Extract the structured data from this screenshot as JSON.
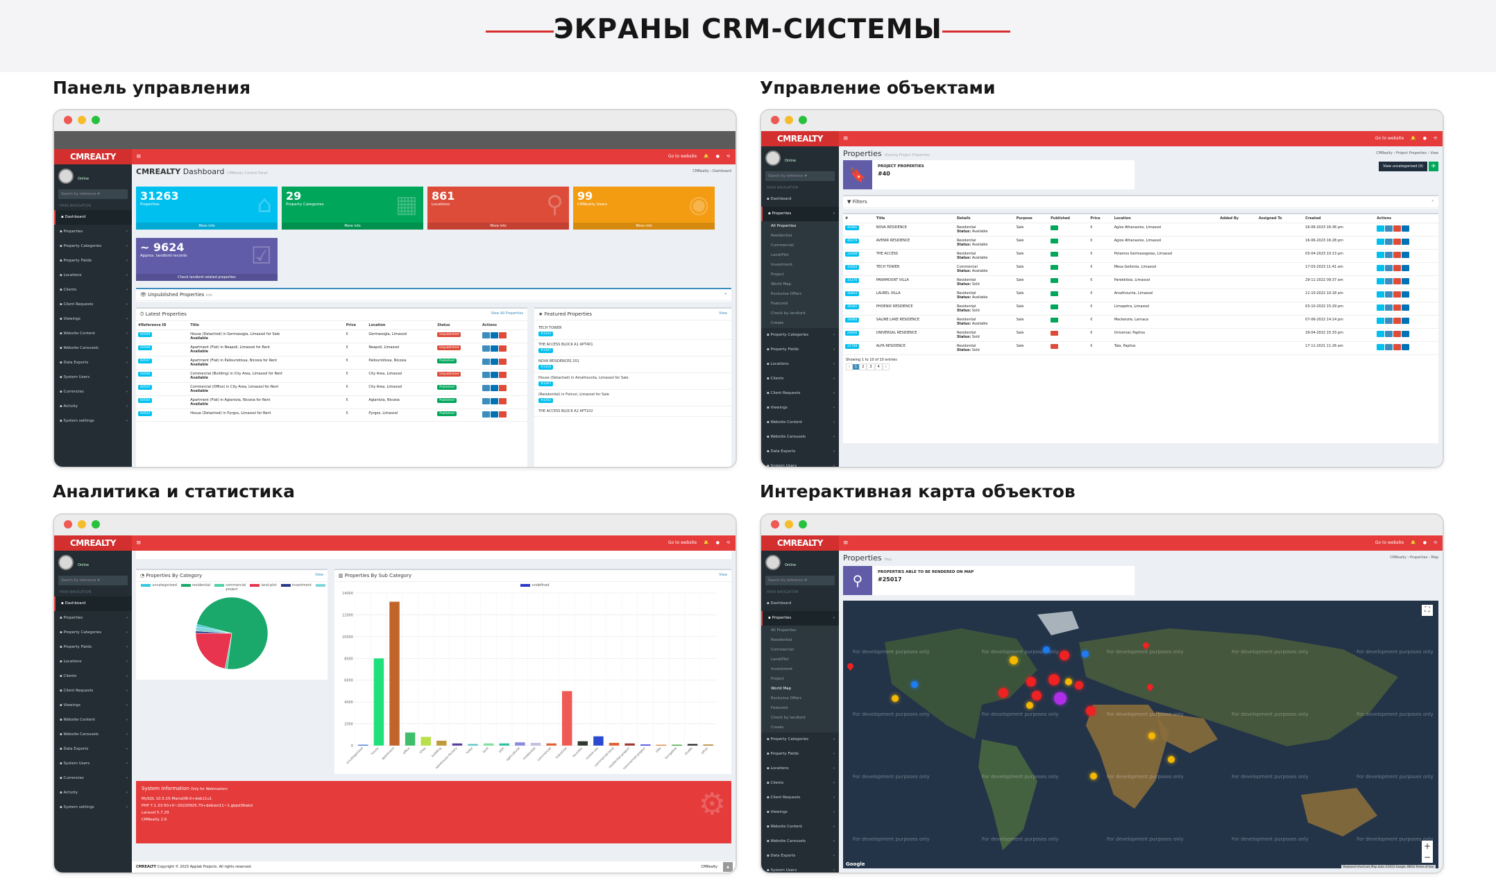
{
  "banner": {
    "title": "ЭКРАНЫ CRM-СИСТЕМЫ"
  },
  "sections": {
    "dashboard": "Панель управления",
    "properties": "Управление объектами",
    "analytics": "Аналитика и статистика",
    "map": "Интерактивная карта объектов"
  },
  "app": {
    "brand": "CMREALTY",
    "go_to_website": "Go to website",
    "online": "Online",
    "search_placeholder": "Search by reference #",
    "main_navigation": "MAIN NAVIGATION",
    "sidebar": [
      "Dashboard",
      "Properties",
      "Property Categories",
      "Property Fields",
      "Locations",
      "Clients",
      "Client Requests",
      "Viewings",
      "Website Content",
      "Website Carousels",
      "Data Exports",
      "System Users",
      "Currencies",
      "Activity",
      "System settings"
    ],
    "properties_sub": [
      "All Properties",
      "Residential",
      "Commercial",
      "Land/Plot",
      "Investment",
      "Project",
      "World Map",
      "Exclusive Offers",
      "Featured",
      "Check by landlord",
      "Create"
    ]
  },
  "dashboard": {
    "title": "Dashboard",
    "subtitle": "CMRealty Control Panel",
    "crumb": "CMRealty  ›  Dashboard",
    "tiles": [
      {
        "num": "31263",
        "label": "Properties",
        "more": "More info",
        "color": "#00c0ef",
        "icon": "home-icon"
      },
      {
        "num": "29",
        "label": "Property Categories",
        "more": "More info",
        "color": "#00a65a",
        "icon": "grid-icon"
      },
      {
        "num": "861",
        "label": "Locations",
        "more": "More info",
        "color": "#dd4b39",
        "icon": "location-icon"
      },
      {
        "num": "99",
        "label": "CMRealty Users",
        "more": "More info",
        "color": "#f39c12",
        "icon": "user-icon"
      }
    ],
    "tile5": {
      "num": "~ 9624",
      "label": "Approx. landlord records",
      "more": "Check landlord related properties",
      "color": "#605ca8"
    },
    "unpublished": {
      "title": "Unpublished Properties",
      "count": "Info"
    },
    "latest": {
      "title": "Latest Properties",
      "view": "View All Properties",
      "headers": [
        "#Reference ID",
        "Title",
        "Price",
        "Location",
        "Status",
        "Actions"
      ],
      "rows": [
        {
          "id": "60509",
          "title": "House (Detached) in Germasogia, Limassol for Sale",
          "sub": "Available",
          "price": "€",
          "loc": "Germasogia, Limassol",
          "status": "Unpublished"
        },
        {
          "id": "60508",
          "title": "Apartment (Flat) in Neapoli, Limassol for Rent",
          "sub": "Available",
          "price": "€",
          "loc": "Neapoli, Limassol",
          "status": "Unpublished"
        },
        {
          "id": "60507",
          "title": "Apartment (Flat) in Pallouriotissa, Nicosia for Rent",
          "sub": "Available",
          "price": "€",
          "loc": "Pallouriotissa, Nicosia",
          "status": "Published"
        },
        {
          "id": "60506",
          "title": "Commercial (Building) in City Area, Limassol for Rent",
          "sub": "Available",
          "price": "€",
          "loc": "City Area, Limassol",
          "status": "Unpublished"
        },
        {
          "id": "60505",
          "title": "Commercial (Office) in City Area, Limassol for Rent",
          "sub": "Available",
          "price": "€",
          "loc": "City Area, Limassol",
          "status": "Published"
        },
        {
          "id": "60504",
          "title": "Apartment (Flat) in Aglantzia, Nicosia for Rent",
          "sub": "Available",
          "price": "€",
          "loc": "Aglantzia, Nicosia",
          "status": "Published"
        },
        {
          "id": "60503",
          "title": "House (Detached) in Pyrgos, Limassol for Rent",
          "sub": "",
          "price": "€",
          "loc": "Pyrgos, Limassol",
          "status": "Published"
        }
      ]
    },
    "featured": {
      "title": "Featured Properties",
      "view": "View",
      "items": [
        {
          "name": "TECH TOWER",
          "badge": "#3333"
        },
        {
          "name": "THE ACCESS BLOCK A1 APT401",
          "badge": "#3367"
        },
        {
          "name": "NOVA RESIDENCES 201",
          "badge": "#3316"
        },
        {
          "name": "House (Detached) in Amathounta, Limassol for Sale",
          "badge": "#3307"
        },
        {
          "name": "(Residential) in Foinuri, Limassol for Sale",
          "badge": "#3302"
        },
        {
          "name": "THE ACCESS BLOCK A2 APT102",
          "badge": ""
        }
      ]
    }
  },
  "properties": {
    "title": "Properties",
    "subtitle": "Viewing Project Properties",
    "crumb": "CMRealty  ›  Project Properties  ›  View",
    "project_label": "PROJECT PROPERTIES",
    "project_count": "#40",
    "view_btn": "View uncategorized (0)",
    "filters": "Filters",
    "headers": [
      "#",
      "Title",
      "Details",
      "Purpose",
      "Published",
      "Price",
      "Location",
      "Added By",
      "Assigned To",
      "Created",
      "Actions"
    ],
    "rows": [
      {
        "id": "40281",
        "title": "NOVA RESIDENCE",
        "cat": "Residential",
        "status": "Available",
        "purpose": "Sale",
        "pub": true,
        "price": "€",
        "loc": "Agios Athanasios, Limassol",
        "created": "16-06-2023 16:36 pm"
      },
      {
        "id": "40279",
        "title": "AVENIR RESIDENCE",
        "cat": "Residential",
        "status": "Available",
        "purpose": "Sale",
        "pub": true,
        "price": "€",
        "loc": "Agios Athanasios, Limassol",
        "created": "16-06-2023 16:28 pm"
      },
      {
        "id": "33598",
        "title": "THE ACCESS",
        "cat": "Residential",
        "status": "Available",
        "purpose": "Sale",
        "pub": true,
        "price": "€",
        "loc": "Potamos Germasogeias, Limassol",
        "created": "03-04-2023 10:13 pm"
      },
      {
        "id": "33564",
        "title": "TECH TOWER",
        "cat": "Commercial",
        "status": "Available",
        "purpose": "Sale",
        "pub": true,
        "price": "€",
        "loc": "Mesa Geitonia, Limassol",
        "created": "17-03-2023 11:41 am"
      },
      {
        "id": "31276",
        "title": "PARAMOUNT VILLA",
        "cat": "Residential",
        "status": "Sold",
        "purpose": "Sale",
        "pub": true,
        "price": "€",
        "loc": "Parekklisia, Limassol",
        "created": "29-11-2022 09:37 am"
      },
      {
        "id": "30403",
        "title": "LAUREL VILLA",
        "cat": "Residential",
        "status": "Available",
        "purpose": "Sale",
        "pub": true,
        "price": "€",
        "loc": "Amathounta, Limassol",
        "created": "11-10-2022 10:18 am"
      },
      {
        "id": "30361",
        "title": "PHOENIX RESIDENCE",
        "cat": "Residential",
        "status": "Sold",
        "purpose": "Sale",
        "pub": true,
        "price": "€",
        "loc": "Limopetra, Limassol",
        "created": "03-10-2022 15:29 pm"
      },
      {
        "id": "30084",
        "title": "SALINE LAKE RESIDENCE",
        "cat": "Residential",
        "status": "Available",
        "purpose": "Sale",
        "pub": true,
        "price": "€",
        "loc": "Mackenzie, Larnaca",
        "created": "07-06-2022 14:14 pm"
      },
      {
        "id": "29095",
        "title": "UNIVERSAL RESIDENCE",
        "cat": "Residential",
        "status": "Sold",
        "purpose": "Sale",
        "pub": false,
        "price": "€",
        "loc": "Universal, Paphos",
        "created": "29-04-2022 15:33 pm"
      },
      {
        "id": "25799",
        "title": "ALFA RESIDENCE",
        "cat": "Residential",
        "status": "Sold",
        "purpose": "Sale",
        "pub": false,
        "price": "€",
        "loc": "Tala, Paphos",
        "created": "17-11-2021 11:26 am"
      }
    ],
    "showing": "Showing 1 to 10 of 10 entries",
    "status_label": "Status:"
  },
  "analytics": {
    "by_category": {
      "title": "Properties By Category",
      "view": "View"
    },
    "by_sub": {
      "title": "Properties By Sub Category",
      "view": "View"
    },
    "sysinfo": {
      "title": "System Information",
      "note": "Only for Webmasters",
      "lines": [
        "MySQL 10.5.15-MariaDB-0+deb11u1",
        "PHP 7.1.33-50+0~20220925.70+debian11~1.gbpd36abd",
        "Laravel 5.7.29",
        "CMRealty 2.6"
      ]
    },
    "footer": "Copyright © 2023 Applab Projects. All rights reserved.",
    "footer_brand": "CMRealty"
  },
  "chart_data": [
    {
      "type": "pie",
      "legend": [
        "uncategorized",
        "residential",
        "commercial",
        "land-plot",
        "investment",
        "project"
      ],
      "colors": [
        "#36c9e0",
        "#1aa86b",
        "#4fd2a6",
        "#e8344e",
        "#2a3a8a",
        "#7fd6d6"
      ],
      "values": [
        1,
        73,
        1,
        22,
        1,
        2
      ]
    },
    {
      "type": "bar",
      "legend": [
        "undefined"
      ],
      "ylim": [
        0,
        14000
      ],
      "yticks": [
        0,
        2000,
        4000,
        6000,
        8000,
        10000,
        12000,
        14000
      ],
      "categories": [
        "uncategorized",
        "house",
        "apartment",
        "office",
        "shop",
        "building",
        "warehouse-factory",
        "hotel",
        "land",
        "plot",
        "agricultural",
        "residential",
        "commercial",
        "industrial",
        "touristic",
        "mixed-use",
        "commercial-land",
        "residential-project",
        "commercial-project",
        "villa",
        "bungalow",
        "studio",
        "other"
      ],
      "values": [
        80,
        8000,
        13200,
        1200,
        800,
        450,
        200,
        150,
        200,
        200,
        300,
        250,
        200,
        5000,
        400,
        850,
        250,
        200,
        100,
        80,
        80,
        150,
        100
      ],
      "colors": [
        "#3c6fd6",
        "#1fe07a",
        "#c0642a",
        "#3fbf6b",
        "#b8e04a",
        "#c09a3a",
        "#5b3e9a",
        "#5bc8c8",
        "#80e0a0",
        "#2ac0a0",
        "#8a8ae0",
        "#c0c0e0",
        "#e06030",
        "#ef5a55",
        "#2e3a2e",
        "#2a4ad0",
        "#e06030",
        "#a03a30",
        "#3a3ae0",
        "#e08030",
        "#30a030",
        "#303030",
        "#b08030"
      ]
    }
  ],
  "map": {
    "title": "Properties",
    "subtitle": "Map",
    "crumb": "CMRealty  ›  Properties  ›  Map",
    "card_label": "PROPERTIES ABLE TO BE RENDERED ON MAP",
    "card_count": "#25017",
    "watermark": "For development purposes only",
    "attribution": "Keyboard shortcuts   Map data ©2023 Google, INEGI   Terms of Use",
    "google": "Google"
  }
}
